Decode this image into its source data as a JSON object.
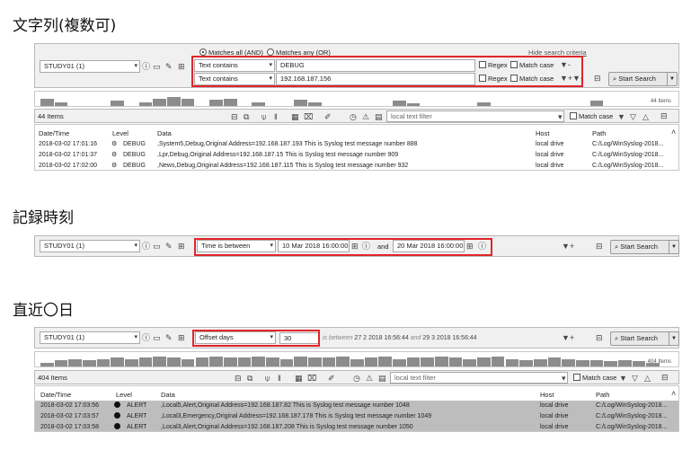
{
  "sections": [
    {
      "heading": "文字列(複数可)"
    },
    {
      "heading": "記録時刻"
    },
    {
      "heading": "直近〇日"
    }
  ],
  "panel1": {
    "source": "STUDY01 (1)",
    "match_all": "Matches all (AND)",
    "match_any": "Matches any (OR)",
    "hide_link": "Hide search criteria",
    "rules": [
      {
        "op": "Text contains",
        "value": "DEBUG",
        "regex": "Regex",
        "matchcase": "Match case"
      },
      {
        "op": "Text contains",
        "value": "192.168.187.156",
        "regex": "Regex",
        "matchcase": "Match case"
      }
    ],
    "start_search": "Start Search",
    "histogram_label": "44 Items",
    "histogram_bars": [
      0.6,
      0.3,
      0,
      0,
      0,
      0.4,
      0,
      0.3,
      0.6,
      0.7,
      0.6,
      0,
      0.5,
      0.6,
      0,
      0.3,
      0,
      0,
      0.5,
      0.3,
      0,
      0,
      0,
      0,
      0,
      0.4,
      0.2,
      0,
      0,
      0,
      0,
      0.3,
      0,
      0,
      0,
      0,
      0,
      0,
      0,
      0.4,
      0,
      0,
      0,
      0
    ],
    "items_count": "44 Items",
    "filter_placeholder": "local text filter",
    "match_case": "Match case",
    "columns": {
      "date": "Date/Time",
      "level": "Level",
      "data": "Data",
      "host": "Host",
      "path": "Path"
    },
    "rows": [
      {
        "date": "2018-03-02 17:01:16",
        "level": "DEBUG",
        "data": ",System5,Debug,Original Address=192.168.187.193 This is Syslog test message number 888",
        "host": "local drive",
        "path": "C:/Log/WinSyslog-2018..."
      },
      {
        "date": "2018-03-02 17:01:37",
        "level": "DEBUG",
        "data": ",Lpr,Debug,Original Address=192.168.187.15 This is Syslog test message number 909",
        "host": "local drive",
        "path": "C:/Log/WinSyslog-2018..."
      },
      {
        "date": "2018-03-02 17:02:00",
        "level": "DEBUG",
        "data": ",News,Debug,Original Address=192.168.187.115 This is Syslog test message number 932",
        "host": "local drive",
        "path": "C:/Log/WinSyslog-2018..."
      }
    ]
  },
  "panel2": {
    "source": "STUDY01 (1)",
    "op": "Time is between",
    "from": "10 Mar 2018 16:00:00",
    "and": "and",
    "to": "20 Mar 2018 16:00:00",
    "start_search": "Start Search"
  },
  "panel3": {
    "source": "STUDY01 (1)",
    "op": "Offset days",
    "value": "30",
    "between_prefix": "is between",
    "between_from": "27 2 2018 16:56:44",
    "between_and": "and",
    "between_to": "29 3 2018 16:56:44",
    "start_search": "Start Search",
    "histogram_label": "404 Items",
    "histogram_bars": [
      0.3,
      0.5,
      0.6,
      0.5,
      0.6,
      0.7,
      0.6,
      0.7,
      0.8,
      0.7,
      0.6,
      0.7,
      0.8,
      0.7,
      0.7,
      0.8,
      0.7,
      0.6,
      0.8,
      0.7,
      0.7,
      0.8,
      0.6,
      0.7,
      0.8,
      0.6,
      0.7,
      0.7,
      0.8,
      0.7,
      0.6,
      0.7,
      0.8,
      0.6,
      0.5,
      0.6,
      0.7,
      0.6,
      0.5,
      0.5,
      0.4,
      0.5,
      0.4,
      0.3
    ],
    "items_count": "404 Items",
    "filter_placeholder": "local text filter",
    "match_case": "Match case",
    "columns": {
      "date": "Date/Time",
      "level": "Level",
      "data": "Data",
      "host": "Host",
      "path": "Path"
    },
    "rows": [
      {
        "date": "2018-03-02 17:03:56",
        "level": "ALERT",
        "data": ",Local5,Alert,Original Address=192.168.187.82 This is Syslog test message number 1048",
        "host": "local drive",
        "path": "C:/Log/WinSyslog-2018..."
      },
      {
        "date": "2018-03-02 17:03:57",
        "level": "ALERT",
        "data": ",Local3,Emergency,Original Address=192.168.187.178 This is Syslog test message number 1049",
        "host": "local drive",
        "path": "C:/Log/WinSyslog-2018..."
      },
      {
        "date": "2018-03-02 17:03:58",
        "level": "ALERT",
        "data": ",Local3,Alert,Original Address=192.168.187.208 This is Syslog test message number 1050",
        "host": "local drive",
        "path": "C:/Log/WinSyslog-2018..."
      }
    ]
  },
  "colors": {
    "highlight": "#e0262b",
    "alert_row": "#bdbdbd",
    "bar": "#8c8c8c"
  }
}
